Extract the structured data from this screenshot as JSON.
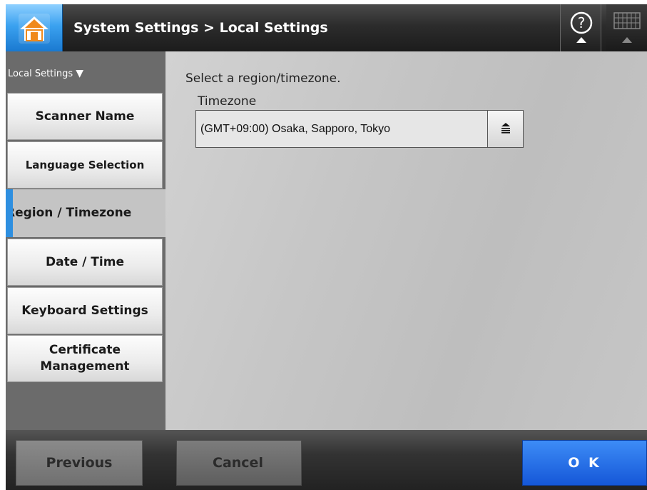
{
  "header": {
    "title": "System Settings > Local Settings",
    "home_icon": "home-icon",
    "help_icon": "help-icon",
    "keyboard_icon": "keyboard-icon"
  },
  "sidebar": {
    "section_label": "Local Settings",
    "section_arrow": "▼",
    "items": [
      {
        "label": "Scanner Name"
      },
      {
        "label": "Language Selection"
      },
      {
        "label": "Region / Timezone",
        "active": true
      },
      {
        "label": "Date / Time"
      },
      {
        "label": "Keyboard Settings"
      },
      {
        "label": "Certificate Management"
      }
    ]
  },
  "main": {
    "prompt": "Select a region/timezone.",
    "timezone_label": "Timezone",
    "timezone_value": "(GMT+09:00) Osaka, Sapporo, Tokyo"
  },
  "footer": {
    "previous_label": "Previous",
    "cancel_label": "Cancel",
    "ok_label": "O K"
  },
  "colors": {
    "accent": "#2e8fe0",
    "ok_button": "#1f6be6",
    "header_bg": "#2c2c2c"
  }
}
